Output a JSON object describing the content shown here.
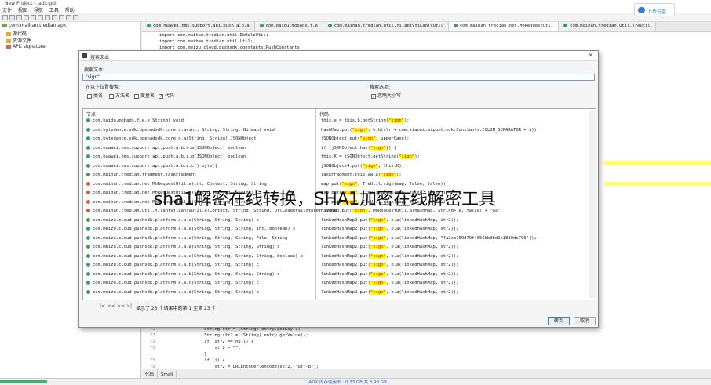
{
  "window": {
    "title": "New Project - jadx-gui"
  },
  "menubar": {
    "items": [
      "文件",
      "视图",
      "导航",
      "工具",
      "帮助"
    ]
  },
  "cloud": {
    "label": "上传云盘"
  },
  "tree": {
    "items": [
      {
        "label": "com.maihan.tredian.apk"
      },
      {
        "label": "源代码"
      },
      {
        "label": "资源文件"
      },
      {
        "label": "APK signature"
      }
    ]
  },
  "tabs": [
    {
      "label": "com.huawei.hms.support.api.push.a.b.a"
    },
    {
      "label": "com.baidu.mobads.f.e"
    },
    {
      "label": "com.maihan.tredian.util.YilantvYiLanTvUtil"
    },
    {
      "label": "com.maihan.tredian.net.MhRequestUtil"
    },
    {
      "label": "com.maihan.tredian.util.TreUtil"
    }
  ],
  "editor_top": {
    "lines": [
      "import com.maihan.tredian.util.DbHelpUtil;",
      "import com.maihan.tredian.util.Util;",
      "import com.meizu.cloud.pushsdk.constants.PushConstants;"
    ]
  },
  "editor_bottom": {
    "lines": [
      {
        "n": "72",
        "code": "    String str = (String) entry.getKey();"
      },
      {
        "n": "72",
        "code": "    String str2 = (String) entry.getValue();"
      },
      {
        "n": "73",
        "code": "    if (str2 == null) {"
      },
      {
        "n": "73",
        "code": "        str2 = \"\";"
      },
      {
        "n": "",
        "code": "    }"
      },
      {
        "n": "75",
        "code": "    if (i) {"
      },
      {
        "n": "78",
        "code": "        str2 = URLEncoder.encode(str2, \"utf-8\");"
      }
    ]
  },
  "bottom_tabs": [
    "代码",
    "Smali"
  ],
  "status": {
    "text": "JADX 内存使用率 : 0.33 GB 共 3.98 GB"
  },
  "dialog": {
    "title": "搜索文本",
    "search_label": "搜索文本:",
    "search_value": "\"sign\"",
    "scope_label": "在以下位置搜索:",
    "scope_options": [
      {
        "label": "类名",
        "checked": ""
      },
      {
        "label": "方法名",
        "checked": ""
      },
      {
        "label": "变量名",
        "checked": ""
      },
      {
        "label": "代码",
        "checked": "✓"
      }
    ],
    "opts_label": "搜索选项:",
    "opts": [
      {
        "label": "忽略大小写",
        "checked": "✓"
      }
    ],
    "col_node": "节点",
    "col_code": "代码",
    "nodes": [
      "com.baidu.mobads.f.e.e(String) void",
      "com.bytedance.sdk.openadsdk.core.o.a(int, String, String, Bitmap) void",
      "com.bytedance.sdk.openadsdk.core.o.a(String, String) JSONObject",
      "com.huawei.hms.support.api.push.a.b.a.a(JSONObject) boolean",
      "com.huawei.hms.support.api.push.a.b.a.g(JSONObject) boolean",
      "com.huawei.hms.support.api.push.a.b.a.c() byte[]",
      "com.maihan.tredian.fragment.TaskFragment",
      "com.maihan.tredian.net.MhRequestUtil.a(int, Context, String, String)",
      "com.maihan.tredian.net.MhRequestUtil.a(String, String, String)",
      "com.maihan.tredian.net.MhRequestUtil.a(String, String, String)",
      "com.maihan.tredian.util.YilantvYiLanTvUtil.a(Context, String, String, UrlLoader$listener) void",
      "com.meizu.cloud.pushsdk.platform.a.a.a(String, String, String) c",
      "com.meizu.cloud.pushsdk.platform.a.a.a(String, String, String, int, boolean) c",
      "com.meizu.cloud.pushsdk.platform.a.a.a(String, String, String, File) String",
      "com.meizu.cloud.pushsdk.platform.a.a.a(String, String, String, String) c",
      "com.meizu.cloud.pushsdk.platform.a.a.a(String, String, String, String, boolean) c",
      "com.meizu.cloud.pushsdk.platform.a.a.b(String, String, String) c",
      "com.meizu.cloud.pushsdk.platform.a.a.b(String, String, String, String) c",
      "com.meizu.cloud.pushsdk.platform.a.a.c(String, String, String) c",
      "com.meizu.cloud.pushsdk.platform.a.a.d(String, String, String) c"
    ],
    "codes": [
      {
        "pre": "this.e = this.b.getString(",
        "hi": "\"sign\"",
        "post": ");"
      },
      {
        "pre": "hashMap.put(",
        "hi": "\"sign\"",
        "post": ", h.b(str + com.xiaomi.mipush.sdk.Constants.COLON_SEPARATOR + i));"
      },
      {
        "pre": "jSONObject.put(",
        "hi": "\"sign\"",
        "post": ", upperCase);"
      },
      {
        "pre": "if (jSONObject.has(",
        "hi": "\"sign\"",
        "post": ")) {"
      },
      {
        "pre": "this.K = jSONObject.getString(",
        "hi": "\"sign\"",
        "post": ");"
      },
      {
        "pre": "jSONObject4.put(",
        "hi": "\"sign\"",
        "post": ", this.K);"
      },
      {
        "pre": "TaskFragment.this.aw.a(",
        "hi": "\"sign\"",
        "post": ");"
      },
      {
        "pre": "map.put(",
        "hi": "\"sign\"",
        "post": ", TreUtil.sign(map, false, false));"
      },
      {
        "pre": "map.put(",
        "hi": "\"sign\"",
        "post": ", TreUtil.sign(map, false, false));"
      },
      {
        "pre": "map.put(",
        "hi": "\"sign\"",
        "post": ", TreUtil.sign(map, false, false));"
      },
      {
        "pre": "hashMap.put(",
        "hi": "\"sign\"",
        "post": ", MhRequestUtil.a(hashMap, String> e, false) + \"&s\""
      },
      {
        "pre": "linkedHashMap2.put(",
        "hi": "\"sign\"",
        "post": ", b.a(linkedHashMap, str2));"
      },
      {
        "pre": "linkedHashMap2.put(",
        "hi": "\"sign\"",
        "post": ", b.a(linkedHashMap, str2));"
      },
      {
        "pre": "linkedHashMap2.put(",
        "hi": "\"sign\"",
        "post": ", b.a(linkedHashMap, \"4a2ca769d79f4056bb3bd9b1830de790\"));"
      },
      {
        "pre": "linkedHashMap2.put(",
        "hi": "\"sign\"",
        "post": ", b.a(linkedHashMap, str2));"
      },
      {
        "pre": "linkedHashMap2.put(",
        "hi": "\"sign\"",
        "post": ", b.a(linkedHashMap, str2));"
      },
      {
        "pre": "linkedHashMap2.put(",
        "hi": "\"sign\"",
        "post": ", b.a(linkedHashMap, str2));"
      },
      {
        "pre": "linkedHashMap2.put(",
        "hi": "\"sign\"",
        "post": ", b.a(linkedHashMap, str2));"
      },
      {
        "pre": "linkedHashMap2.put(",
        "hi": "\"sign\"",
        "post": ", b.a(linkedHashMap, str2));"
      },
      {
        "pre": "linkedHashMap2.put(",
        "hi": "\"sign\"",
        "post": ", b.a(linkedHashMap, str2));"
      }
    ],
    "pager_first": "|<",
    "pager_prev": "<<",
    "pager_next": ">>",
    "pager_last": ">|",
    "pager_info": "显示了 23 个结果中的第 1 至第 23 个",
    "goto_label": "转到",
    "cancel_label": "取消"
  },
  "overlay": {
    "text": "sha1解密在线转换，SHA1加密在线解密工具"
  }
}
